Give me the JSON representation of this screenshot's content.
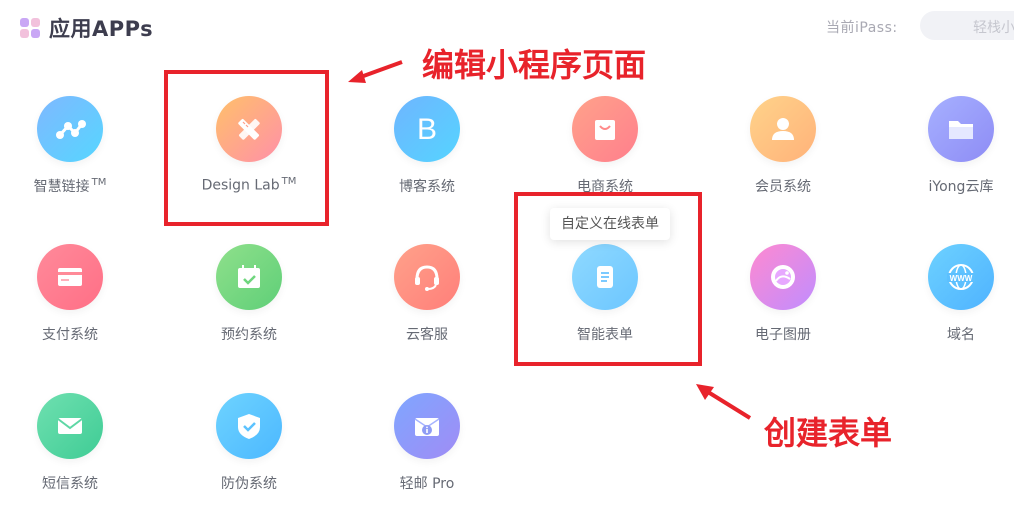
{
  "header": {
    "title": "应用APPs",
    "ipass_label": "当前iPass:",
    "ipass_value": "轻栈小"
  },
  "apps": [
    {
      "label": "智慧链接",
      "tm": "TM",
      "icon": "link-nodes-icon"
    },
    {
      "label": "Design Lab",
      "tm": "TM",
      "icon": "design-pencil-ruler-icon"
    },
    {
      "label": "博客系统",
      "icon": "blog-b-icon"
    },
    {
      "label": "电商系统",
      "icon": "shopping-bag-icon"
    },
    {
      "label": "会员系统",
      "icon": "user-icon"
    },
    {
      "label": "iYong云库",
      "icon": "folder-icon"
    },
    {
      "label": "支付系统",
      "icon": "card-icon"
    },
    {
      "label": "预约系统",
      "icon": "calendar-check-icon"
    },
    {
      "label": "云客服",
      "icon": "headset-icon"
    },
    {
      "label": "智能表单",
      "icon": "form-doc-icon"
    },
    {
      "label": "电子图册",
      "icon": "album-icon"
    },
    {
      "label": "域名",
      "icon": "globe-www-icon"
    },
    {
      "label": "短信系统",
      "icon": "mail-icon"
    },
    {
      "label": "防伪系统",
      "icon": "shield-check-icon"
    },
    {
      "label": "轻邮 Pro",
      "icon": "mail-info-icon"
    }
  ],
  "tooltip": "自定义在线表单",
  "annotations": {
    "top": "编辑小程序页面",
    "bottom": "创建表单"
  },
  "colors": {
    "annotation_red": "#e8232b",
    "label_gray": "#666a74",
    "title": "#3d3d4e"
  }
}
